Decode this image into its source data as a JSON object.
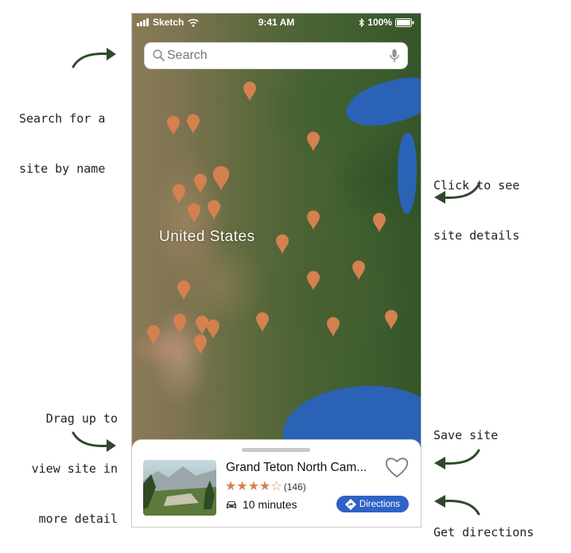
{
  "annotations": {
    "search": [
      "Search for a",
      "site by name"
    ],
    "details": [
      "Click to see",
      "site details"
    ],
    "drag": [
      "Drag up to",
      "view site in",
      "more detail"
    ],
    "save": "Save site",
    "directions": "Get directions"
  },
  "status_bar": {
    "carrier": "Sketch",
    "time": "9:41 AM",
    "battery": "100%"
  },
  "search": {
    "placeholder": "Search",
    "icon": "search-icon",
    "mic_icon": "microphone-icon"
  },
  "map": {
    "label": "United States",
    "pin_color": "#d4814f",
    "water_color": "#2a63b5"
  },
  "site_card": {
    "title": "Grand Teton North Cam...",
    "rating": 4,
    "rating_max": 5,
    "review_count": "(146)",
    "travel_time": "10 minutes",
    "directions_label": "Directions",
    "accent_color": "#2f62c5"
  }
}
